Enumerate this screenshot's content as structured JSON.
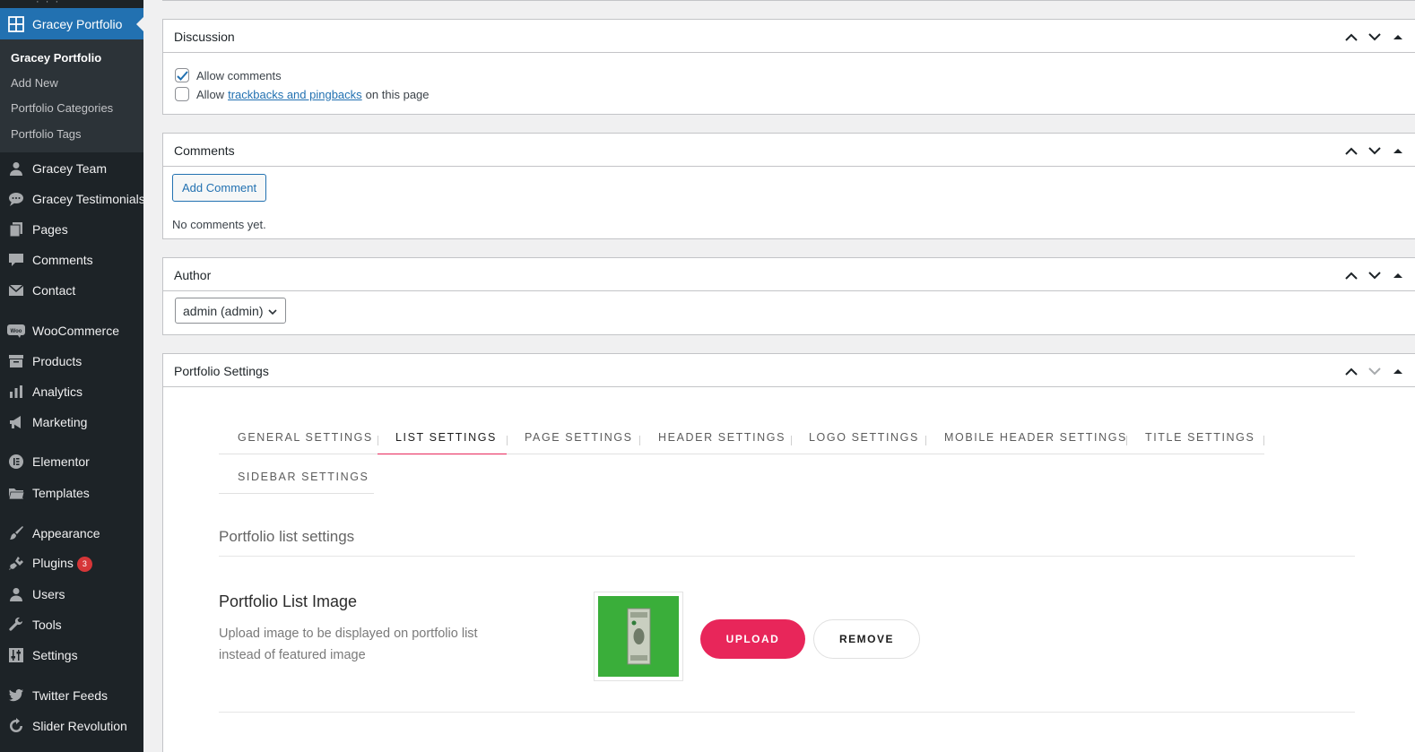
{
  "sidebar": {
    "current": {
      "label": "Gracey Portfolio",
      "icon": "grid-icon"
    },
    "submenu": [
      {
        "label": "Gracey Portfolio",
        "active": true
      },
      {
        "label": "Add New"
      },
      {
        "label": "Portfolio Categories"
      },
      {
        "label": "Portfolio Tags"
      }
    ],
    "items": [
      {
        "label": "Gracey Team",
        "icon": "user-icon"
      },
      {
        "label": "Gracey Testimonials",
        "icon": "speech-bubbles-icon"
      },
      {
        "label": "Pages",
        "icon": "pages-icon"
      },
      {
        "label": "Comments",
        "icon": "comment-icon"
      },
      {
        "label": "Contact",
        "icon": "envelope-icon"
      },
      {
        "label": "WooCommerce",
        "icon": "woo-icon"
      },
      {
        "label": "Products",
        "icon": "archive-icon"
      },
      {
        "label": "Analytics",
        "icon": "bar-chart-icon"
      },
      {
        "label": "Marketing",
        "icon": "megaphone-icon"
      },
      {
        "label": "Elementor",
        "icon": "elementor-icon"
      },
      {
        "label": "Templates",
        "icon": "folder-icon"
      },
      {
        "label": "Appearance",
        "icon": "paintbrush-icon"
      },
      {
        "label": "Plugins",
        "icon": "plug-icon",
        "badge": "3"
      },
      {
        "label": "Users",
        "icon": "users-icon"
      },
      {
        "label": "Tools",
        "icon": "wrench-icon"
      },
      {
        "label": "Settings",
        "icon": "sliders-icon"
      },
      {
        "label": "Twitter Feeds",
        "icon": "twitter-icon"
      },
      {
        "label": "Slider Revolution",
        "icon": "refresh-icon"
      }
    ]
  },
  "discussion": {
    "title": "Discussion",
    "allow_comments": {
      "label": "Allow comments",
      "checked": true
    },
    "allow_trackbacks": {
      "prefix": "Allow",
      "link": "trackbacks and pingbacks",
      "suffix": "on this page",
      "checked": false
    }
  },
  "comments": {
    "title": "Comments",
    "add_button": "Add Comment",
    "empty_text": "No comments yet."
  },
  "author": {
    "title": "Author",
    "selected": "admin (admin)"
  },
  "portfolio_settings": {
    "title": "Portfolio Settings",
    "tabs": [
      "GENERAL SETTINGS",
      "LIST SETTINGS",
      "PAGE SETTINGS",
      "HEADER SETTINGS",
      "LOGO SETTINGS",
      "MOBILE HEADER SETTINGS",
      "TITLE SETTINGS",
      "SIDEBAR SETTINGS"
    ],
    "active_tab": "LIST SETTINGS",
    "section_title": "Portfolio list settings",
    "field": {
      "title": "Portfolio List Image",
      "description": "Upload image to be displayed on portfolio list instead of featured image",
      "upload_label": "UPLOAD",
      "remove_label": "REMOVE"
    }
  },
  "colors": {
    "sidebar_bg": "#1d2327",
    "sidebar_active": "#2271b1",
    "accent": "#e8265a",
    "badge": "#d63638"
  }
}
